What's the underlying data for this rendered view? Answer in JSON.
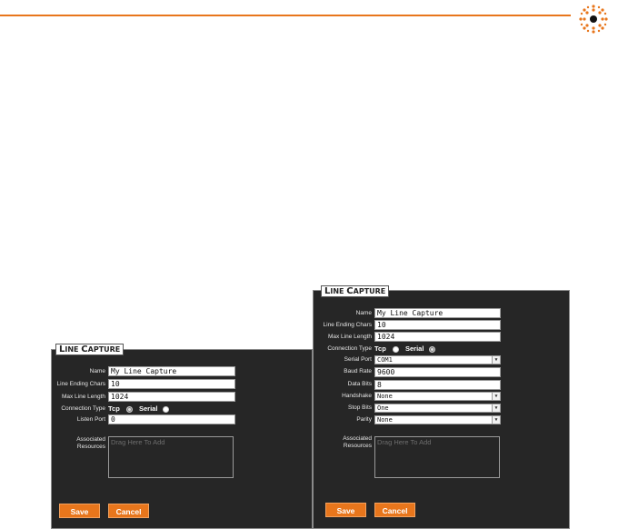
{
  "colors": {
    "accent": "#e8761c",
    "panel_bg": "#262626"
  },
  "left_panel": {
    "title_cap1": "L",
    "title_rest1": "INE ",
    "title_cap2": "C",
    "title_rest2": "APTURE",
    "name_label": "Name",
    "name_value": "My Line Capture",
    "line_ending_label": "Line Ending Chars",
    "line_ending_value": "10",
    "max_line_label": "Max Line Length",
    "max_line_value": "1024",
    "connection_label": "Connection Type",
    "tcp_label": "Tcp",
    "serial_label": "Serial",
    "selected": "Tcp",
    "listen_port_label": "Listen Port",
    "listen_port_value": "0",
    "resources_label_1": "Associated",
    "resources_label_2": "Resources",
    "drag_placeholder": "Drag Here To Add",
    "save_label": "Save",
    "cancel_label": "Cancel"
  },
  "right_panel": {
    "title_cap1": "L",
    "title_rest1": "INE ",
    "title_cap2": "C",
    "title_rest2": "APTURE",
    "name_label": "Name",
    "name_value": "My Line Capture",
    "line_ending_label": "Line Ending Chars",
    "line_ending_value": "10",
    "max_line_label": "Max Line Length",
    "max_line_value": "1024",
    "connection_label": "Connection Type",
    "tcp_label": "Tcp",
    "serial_label": "Serial",
    "selected": "Serial",
    "serial_port_label": "Serial Port",
    "serial_port_value": "COM1",
    "baud_rate_label": "Baud Rate",
    "baud_rate_value": "9600",
    "data_bits_label": "Data Bits",
    "data_bits_value": "8",
    "handshake_label": "Handshake",
    "handshake_value": "None",
    "stop_bits_label": "Stop Bits",
    "stop_bits_value": "One",
    "parity_label": "Parity",
    "parity_value": "None",
    "resources_label_1": "Associated",
    "resources_label_2": "Resources",
    "drag_placeholder": "Drag Here To Add",
    "save_label": "Save",
    "cancel_label": "Cancel"
  },
  "icons": {
    "logo": "radiating-dots-logo-icon",
    "dropdown": "chevron-down-icon"
  }
}
